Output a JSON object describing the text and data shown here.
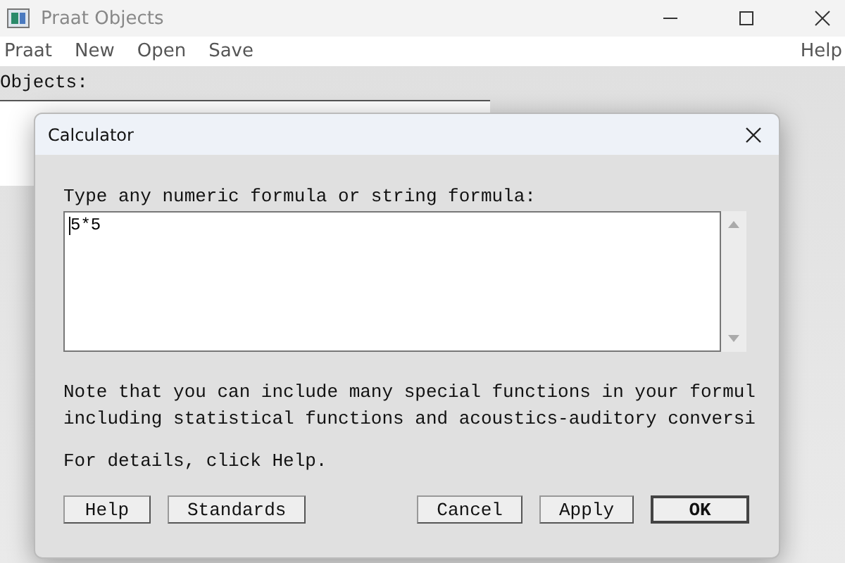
{
  "window": {
    "title": "Praat Objects"
  },
  "menu": [
    "Praat",
    "New",
    "Open",
    "Save"
  ],
  "menu_right": "Help",
  "objects_label": "Objects:",
  "dialog": {
    "title": "Calculator",
    "prompt": "Type any numeric formula or string formula:",
    "formula": "5*5",
    "notes": [
      "Note that you can include many special functions in your formul",
      "including statistical functions and acoustics-auditory conversi"
    ],
    "details": "For details, click Help.",
    "buttons_left": [
      {
        "label": "Help",
        "default": false
      },
      {
        "label": "Standards",
        "default": false
      }
    ],
    "buttons_right": [
      {
        "label": "Cancel",
        "default": false
      },
      {
        "label": "Apply",
        "default": false
      },
      {
        "label": "OK",
        "default": true
      }
    ]
  }
}
